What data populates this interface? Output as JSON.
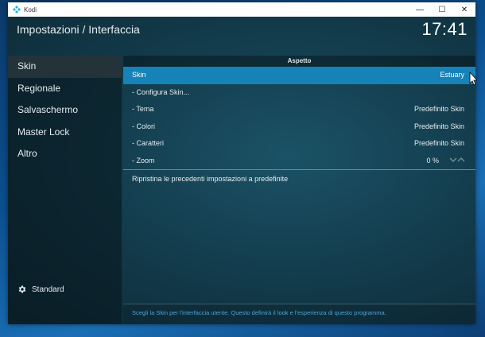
{
  "window": {
    "app_name": "Kodi",
    "controls": {
      "minimize": "—",
      "maximize": "☐",
      "close": "✕"
    }
  },
  "header": {
    "title": "Impostazioni / Interfaccia",
    "clock": "17:41"
  },
  "sidebar": {
    "items": [
      {
        "label": "Skin",
        "active": true
      },
      {
        "label": "Regionale",
        "active": false
      },
      {
        "label": "Salvaschermo",
        "active": false
      },
      {
        "label": "Master Lock",
        "active": false
      },
      {
        "label": "Altro",
        "active": false
      }
    ],
    "level_label": "Standard"
  },
  "panel": {
    "section_title": "Aspetto",
    "rows": [
      {
        "label": "Skin",
        "value": "Estuary",
        "selected": true
      },
      {
        "label": "- Configura Skin...",
        "value": ""
      },
      {
        "label": "- Tema",
        "value": "Predefinito Skin"
      },
      {
        "label": "- Colori",
        "value": "Predefinito Skin"
      },
      {
        "label": "- Caratteri",
        "value": "Predefinito Skin"
      },
      {
        "label": "- Zoom",
        "value": "0 %"
      }
    ],
    "reset_label": "Ripristina le precedenti impostazioni a predefinite",
    "help_text": "Scegli la Skin per l'interfaccia utente. Questo definirà il look e l'esperienza di questo programma."
  },
  "colors": {
    "selection": "#1583b8",
    "help_text": "#4aa6d6",
    "background": "#102631"
  },
  "icons": {
    "app": "kodi-icon",
    "settings_level": "gear-icon",
    "zoom_controls": "chevron-up-down-icons"
  }
}
